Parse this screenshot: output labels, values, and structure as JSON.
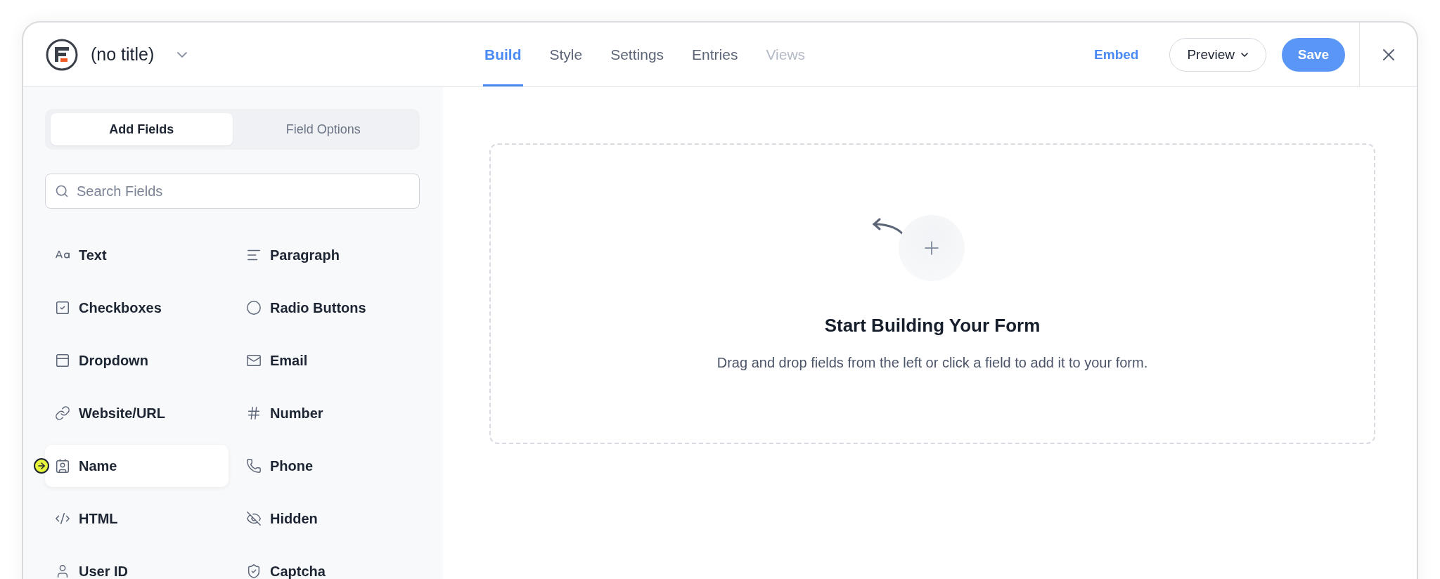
{
  "header": {
    "title": "(no title)",
    "tabs": [
      {
        "label": "Build",
        "selected": true,
        "disabled": false
      },
      {
        "label": "Style",
        "selected": false,
        "disabled": false
      },
      {
        "label": "Settings",
        "selected": false,
        "disabled": false
      },
      {
        "label": "Entries",
        "selected": false,
        "disabled": false
      },
      {
        "label": "Views",
        "selected": false,
        "disabled": true
      }
    ],
    "embed": "Embed",
    "preview": "Preview",
    "save": "Save"
  },
  "sidebar": {
    "tabs": [
      {
        "label": "Add Fields",
        "selected": true
      },
      {
        "label": "Field Options",
        "selected": false
      }
    ],
    "search": {
      "placeholder": "Search Fields"
    },
    "fields": [
      {
        "label": "Text",
        "highlighted": false
      },
      {
        "label": "Paragraph",
        "highlighted": false
      },
      {
        "label": "Checkboxes",
        "highlighted": false
      },
      {
        "label": "Radio Buttons",
        "highlighted": false
      },
      {
        "label": "Dropdown",
        "highlighted": false
      },
      {
        "label": "Email",
        "highlighted": false
      },
      {
        "label": "Website/URL",
        "highlighted": false
      },
      {
        "label": "Number",
        "highlighted": false
      },
      {
        "label": "Name",
        "highlighted": true
      },
      {
        "label": "Phone",
        "highlighted": false
      },
      {
        "label": "HTML",
        "highlighted": false
      },
      {
        "label": "Hidden",
        "highlighted": false
      },
      {
        "label": "User ID",
        "highlighted": false
      },
      {
        "label": "Captcha",
        "highlighted": false
      }
    ]
  },
  "canvas": {
    "heading": "Start Building Your Form",
    "description": "Drag and drop fields from the left or click a field to add it to your form."
  }
}
